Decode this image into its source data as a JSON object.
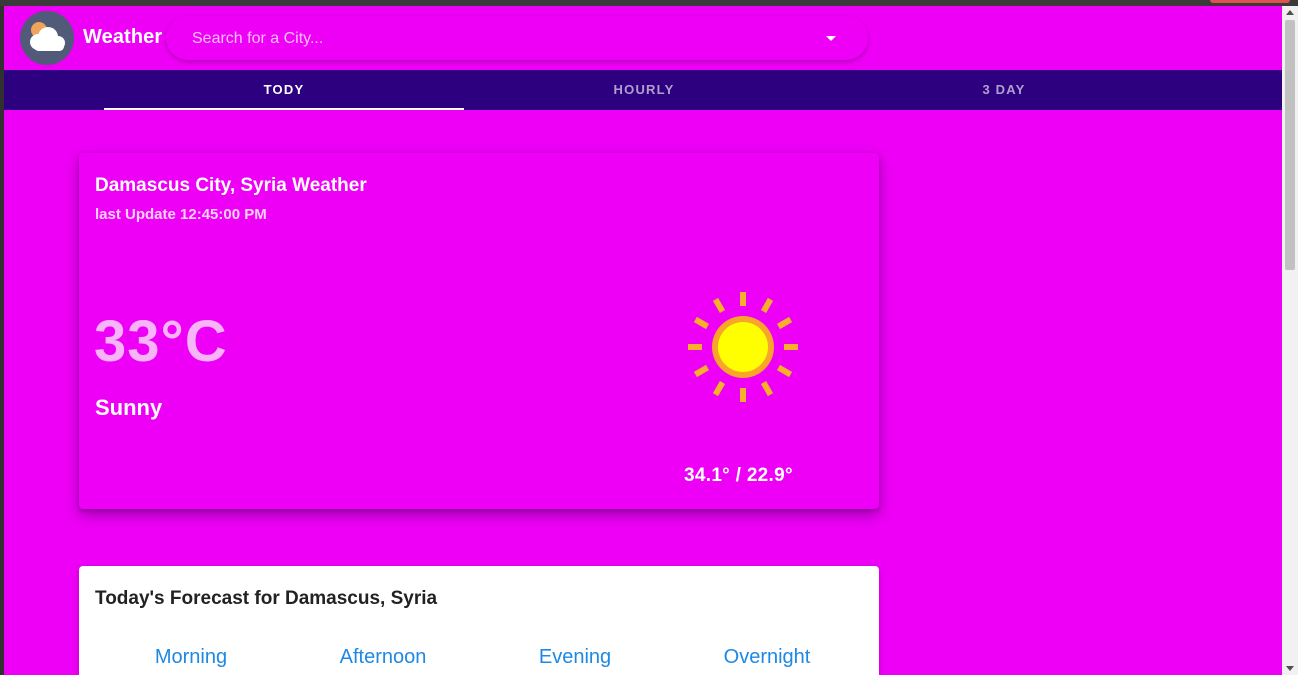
{
  "header": {
    "title": "Weather",
    "logo_icon": "cloud-sun-icon",
    "search_placeholder": "Search for a City...",
    "dropdown_icon": "caret-down-icon"
  },
  "tabs": [
    {
      "label": "TODY",
      "active": true
    },
    {
      "label": "HOURLY",
      "active": false
    },
    {
      "label": "3 DAY",
      "active": false
    }
  ],
  "current": {
    "title": "Damascus City, Syria Weather",
    "last_update": "last Update 12:45:00 PM",
    "temperature": "33°C",
    "condition": "Sunny",
    "condition_icon": "sun-icon",
    "high_low": "34.1° / 22.9°"
  },
  "forecast": {
    "title": "Today's Forecast for Damascus, Syria",
    "periods": [
      "Morning",
      "Afternoon",
      "Evening",
      "Overnight"
    ]
  },
  "colors": {
    "background": "#ee00f6",
    "tab_bar": "#2d007f",
    "link_blue": "#1e88e5",
    "temp_text": "#f7b4f9"
  }
}
